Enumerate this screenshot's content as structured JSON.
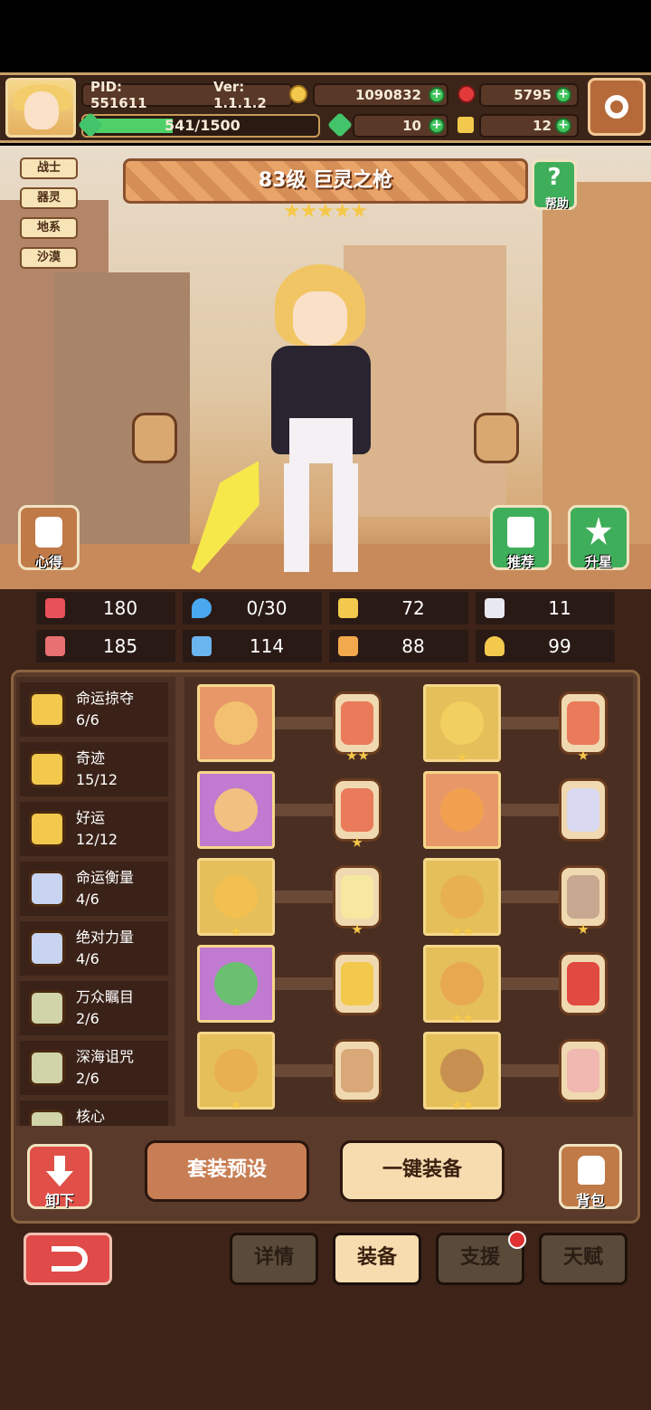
{
  "header": {
    "pid": "PID: 551611",
    "version": "Ver: 1.1.1.2",
    "gold": "1090832",
    "gems": "5795",
    "xp": "541/1500",
    "xp_progress": 0.36,
    "clovers": "10",
    "keys": "12"
  },
  "tags": [
    "战士",
    "器灵",
    "地系",
    "沙漠"
  ],
  "hero": {
    "title": "83级  巨灵之枪",
    "stars": 5,
    "help_label": "帮助",
    "insight_label": "心得",
    "recommend_label": "推荐",
    "upgrade_label": "升星"
  },
  "stats": [
    {
      "icon": "heart-icon",
      "value": "180",
      "color": "#e8505a"
    },
    {
      "icon": "mana-drop-icon",
      "value": "0/30",
      "color": "#4aa8f0"
    },
    {
      "icon": "shield-icon",
      "value": "72",
      "color": "#f2c94c"
    },
    {
      "icon": "wing-icon",
      "value": "11",
      "color": "#e8e8f0"
    },
    {
      "icon": "fist-icon",
      "value": "185",
      "color": "#e87070"
    },
    {
      "icon": "book-icon",
      "value": "114",
      "color": "#6ab4f0"
    },
    {
      "icon": "boot-icon",
      "value": "88",
      "color": "#f2a84c"
    },
    {
      "icon": "horseshoe-icon",
      "value": "99",
      "color": "#f2c94c"
    }
  ],
  "sets": [
    {
      "name": "命运掠夺",
      "count": "6/6",
      "color": "#f2c94c"
    },
    {
      "name": "奇迹",
      "count": "15/12",
      "color": "#f2c94c"
    },
    {
      "name": "好运",
      "count": "12/12",
      "color": "#f2c94c"
    },
    {
      "name": "命运衡量",
      "count": "4/6",
      "color": "#c8d4f0"
    },
    {
      "name": "绝对力量",
      "count": "4/6",
      "color": "#c8d4f0"
    },
    {
      "name": "万众瞩目",
      "count": "2/6",
      "color": "#d0d4a8"
    },
    {
      "name": "深海诅咒",
      "count": "2/6",
      "color": "#d0d4a8"
    },
    {
      "name": "核心",
      "count": "",
      "color": "#d0d4a8"
    }
  ],
  "equipment": [
    {
      "slot": "weapon",
      "bg": "#e89868",
      "art": "#f2c070",
      "gem": "#e97a5a",
      "gem_stars": 2,
      "slot_stars": 0
    },
    {
      "slot": "helmet",
      "bg": "#e4bf5a",
      "art": "#f2d060",
      "gem": "#e97a5a",
      "gem_stars": 1,
      "slot_stars": 1
    },
    {
      "slot": "amulet",
      "bg": "#c07ad0",
      "art": "#f2c080",
      "gem": "#e97a5a",
      "gem_stars": 1,
      "slot_stars": 0
    },
    {
      "slot": "armor",
      "bg": "#e89868",
      "art": "#f2a050",
      "gem": "#d8d8f0",
      "gem_stars": 0,
      "slot_stars": 0
    },
    {
      "slot": "necklace",
      "bg": "#e4bf5a",
      "art": "#f2c050",
      "gem": "#f6e8a0",
      "gem_stars": 1,
      "slot_stars": 1
    },
    {
      "slot": "gloves",
      "bg": "#e4bf5a",
      "art": "#e8b050",
      "gem": "#c8a890",
      "gem_stars": 1,
      "slot_stars": 2
    },
    {
      "slot": "relic",
      "bg": "#c07ad0",
      "art": "#6ac070",
      "gem": "#f2c94c",
      "gem_stars": 0,
      "slot_stars": 0
    },
    {
      "slot": "belt",
      "bg": "#e4bf5a",
      "art": "#e8a850",
      "gem": "#e04a40",
      "gem_stars": 0,
      "slot_stars": 2
    },
    {
      "slot": "ring",
      "bg": "#e4bf5a",
      "art": "#e8b050",
      "gem": "#d8a878",
      "gem_stars": 0,
      "slot_stars": 1
    },
    {
      "slot": "boots",
      "bg": "#e4bf5a",
      "art": "#c89050",
      "gem": "#f0b8b0",
      "gem_stars": 0,
      "slot_stars": 2
    }
  ],
  "actions": {
    "unequip": "卸下",
    "preset": "套装预设",
    "auto_equip": "一键装备",
    "bag": "背包"
  },
  "tabs": {
    "details": "详情",
    "equipment": "装备",
    "support": "支援",
    "talent": "天赋"
  }
}
